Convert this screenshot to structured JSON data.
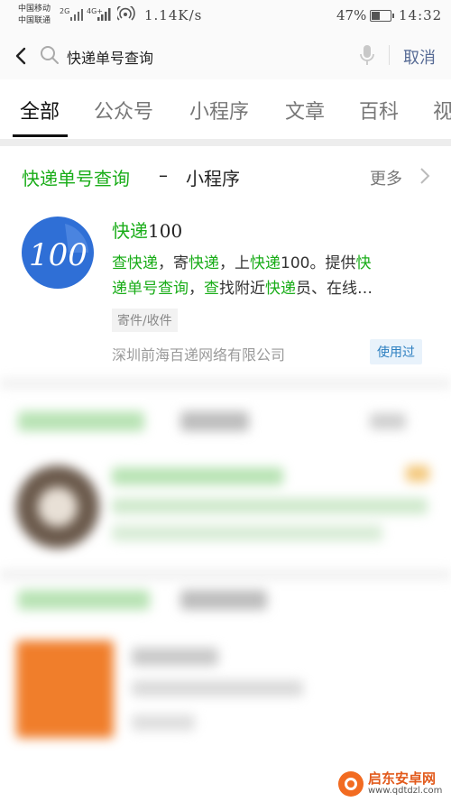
{
  "status_bar": {
    "carrier_1": "中国移动",
    "carrier_2": "中国联通",
    "sig_1": "2G",
    "sig_2": "4G+",
    "speed": "1.14K/s",
    "battery": "47%",
    "battery_level": 0.47,
    "time": "14:32"
  },
  "search": {
    "query": "快递单号查询",
    "cancel": "取消"
  },
  "tabs": [
    {
      "label": "全部"
    },
    {
      "label": "公众号"
    },
    {
      "label": "小程序"
    },
    {
      "label": "文章"
    },
    {
      "label": "百科"
    },
    {
      "label": "视"
    }
  ],
  "section": {
    "title": "快递单号查询",
    "dash": "–",
    "type": "小程序",
    "more": "更多"
  },
  "result": {
    "name_hl": "快递",
    "name_rest": "100",
    "desc_line1": [
      {
        "t": "查快递",
        "hl": true
      },
      {
        "t": "，寄",
        "hl": false
      },
      {
        "t": "快递",
        "hl": true
      },
      {
        "t": "，上",
        "hl": false
      },
      {
        "t": "快递",
        "hl": true
      },
      {
        "t": "100。提供",
        "hl": false
      },
      {
        "t": "快",
        "hl": true
      }
    ],
    "desc_line2": [
      {
        "t": "递单号查询",
        "hl": true
      },
      {
        "t": "，",
        "hl": false
      },
      {
        "t": "查",
        "hl": true
      },
      {
        "t": "找附近",
        "hl": false
      },
      {
        "t": "快递",
        "hl": true
      },
      {
        "t": "员、在线…",
        "hl": false
      }
    ],
    "tag": "寄件/收件",
    "company": "深圳前海百递网络有限公司",
    "used": "使用过",
    "logo_text": "100"
  },
  "watermark": {
    "name": "启东安卓网",
    "url": "www.qdtdzl.com"
  },
  "colors": {
    "highlight": "#1aad19",
    "link": "#576b95",
    "logo_blue": "#2f6fd6"
  }
}
